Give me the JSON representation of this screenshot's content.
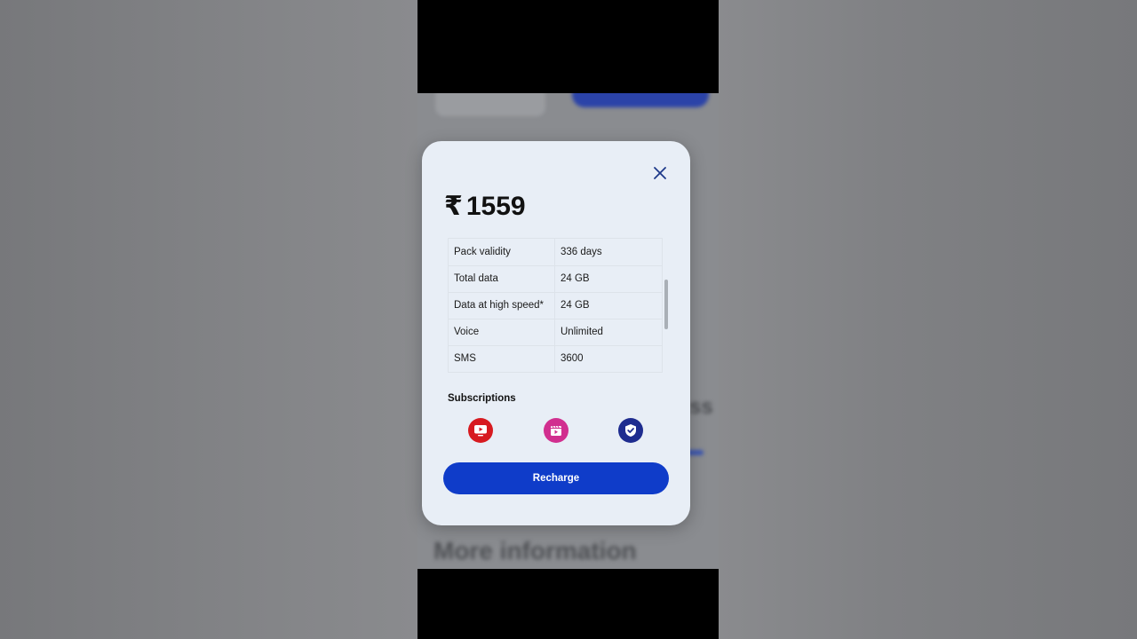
{
  "plan": {
    "price_symbol": "₹",
    "price_amount": "1559"
  },
  "details": [
    {
      "label": "Pack validity",
      "value": "336 days"
    },
    {
      "label": "Total data",
      "value": "24 GB"
    },
    {
      "label": "Data at high speed*",
      "value": "24 GB"
    },
    {
      "label": "Voice",
      "value": "Unlimited"
    },
    {
      "label": "SMS",
      "value": "3600"
    }
  ],
  "subscriptions": {
    "title": "Subscriptions",
    "icons": [
      {
        "icon": "tv-play-icon",
        "color": "#d71a20"
      },
      {
        "icon": "cinema-clapper-icon",
        "color": "#d12f8f"
      },
      {
        "icon": "shield-check-icon",
        "color": "#1e2c8f"
      }
    ]
  },
  "actions": {
    "recharge_label": "Recharge"
  },
  "background": {
    "heading_text": "More information",
    "fragment_text": "ss"
  },
  "colors": {
    "primary": "#0f3cc9",
    "modal_bg": "#e8eef6",
    "close_icon": "#1e3a8a"
  }
}
